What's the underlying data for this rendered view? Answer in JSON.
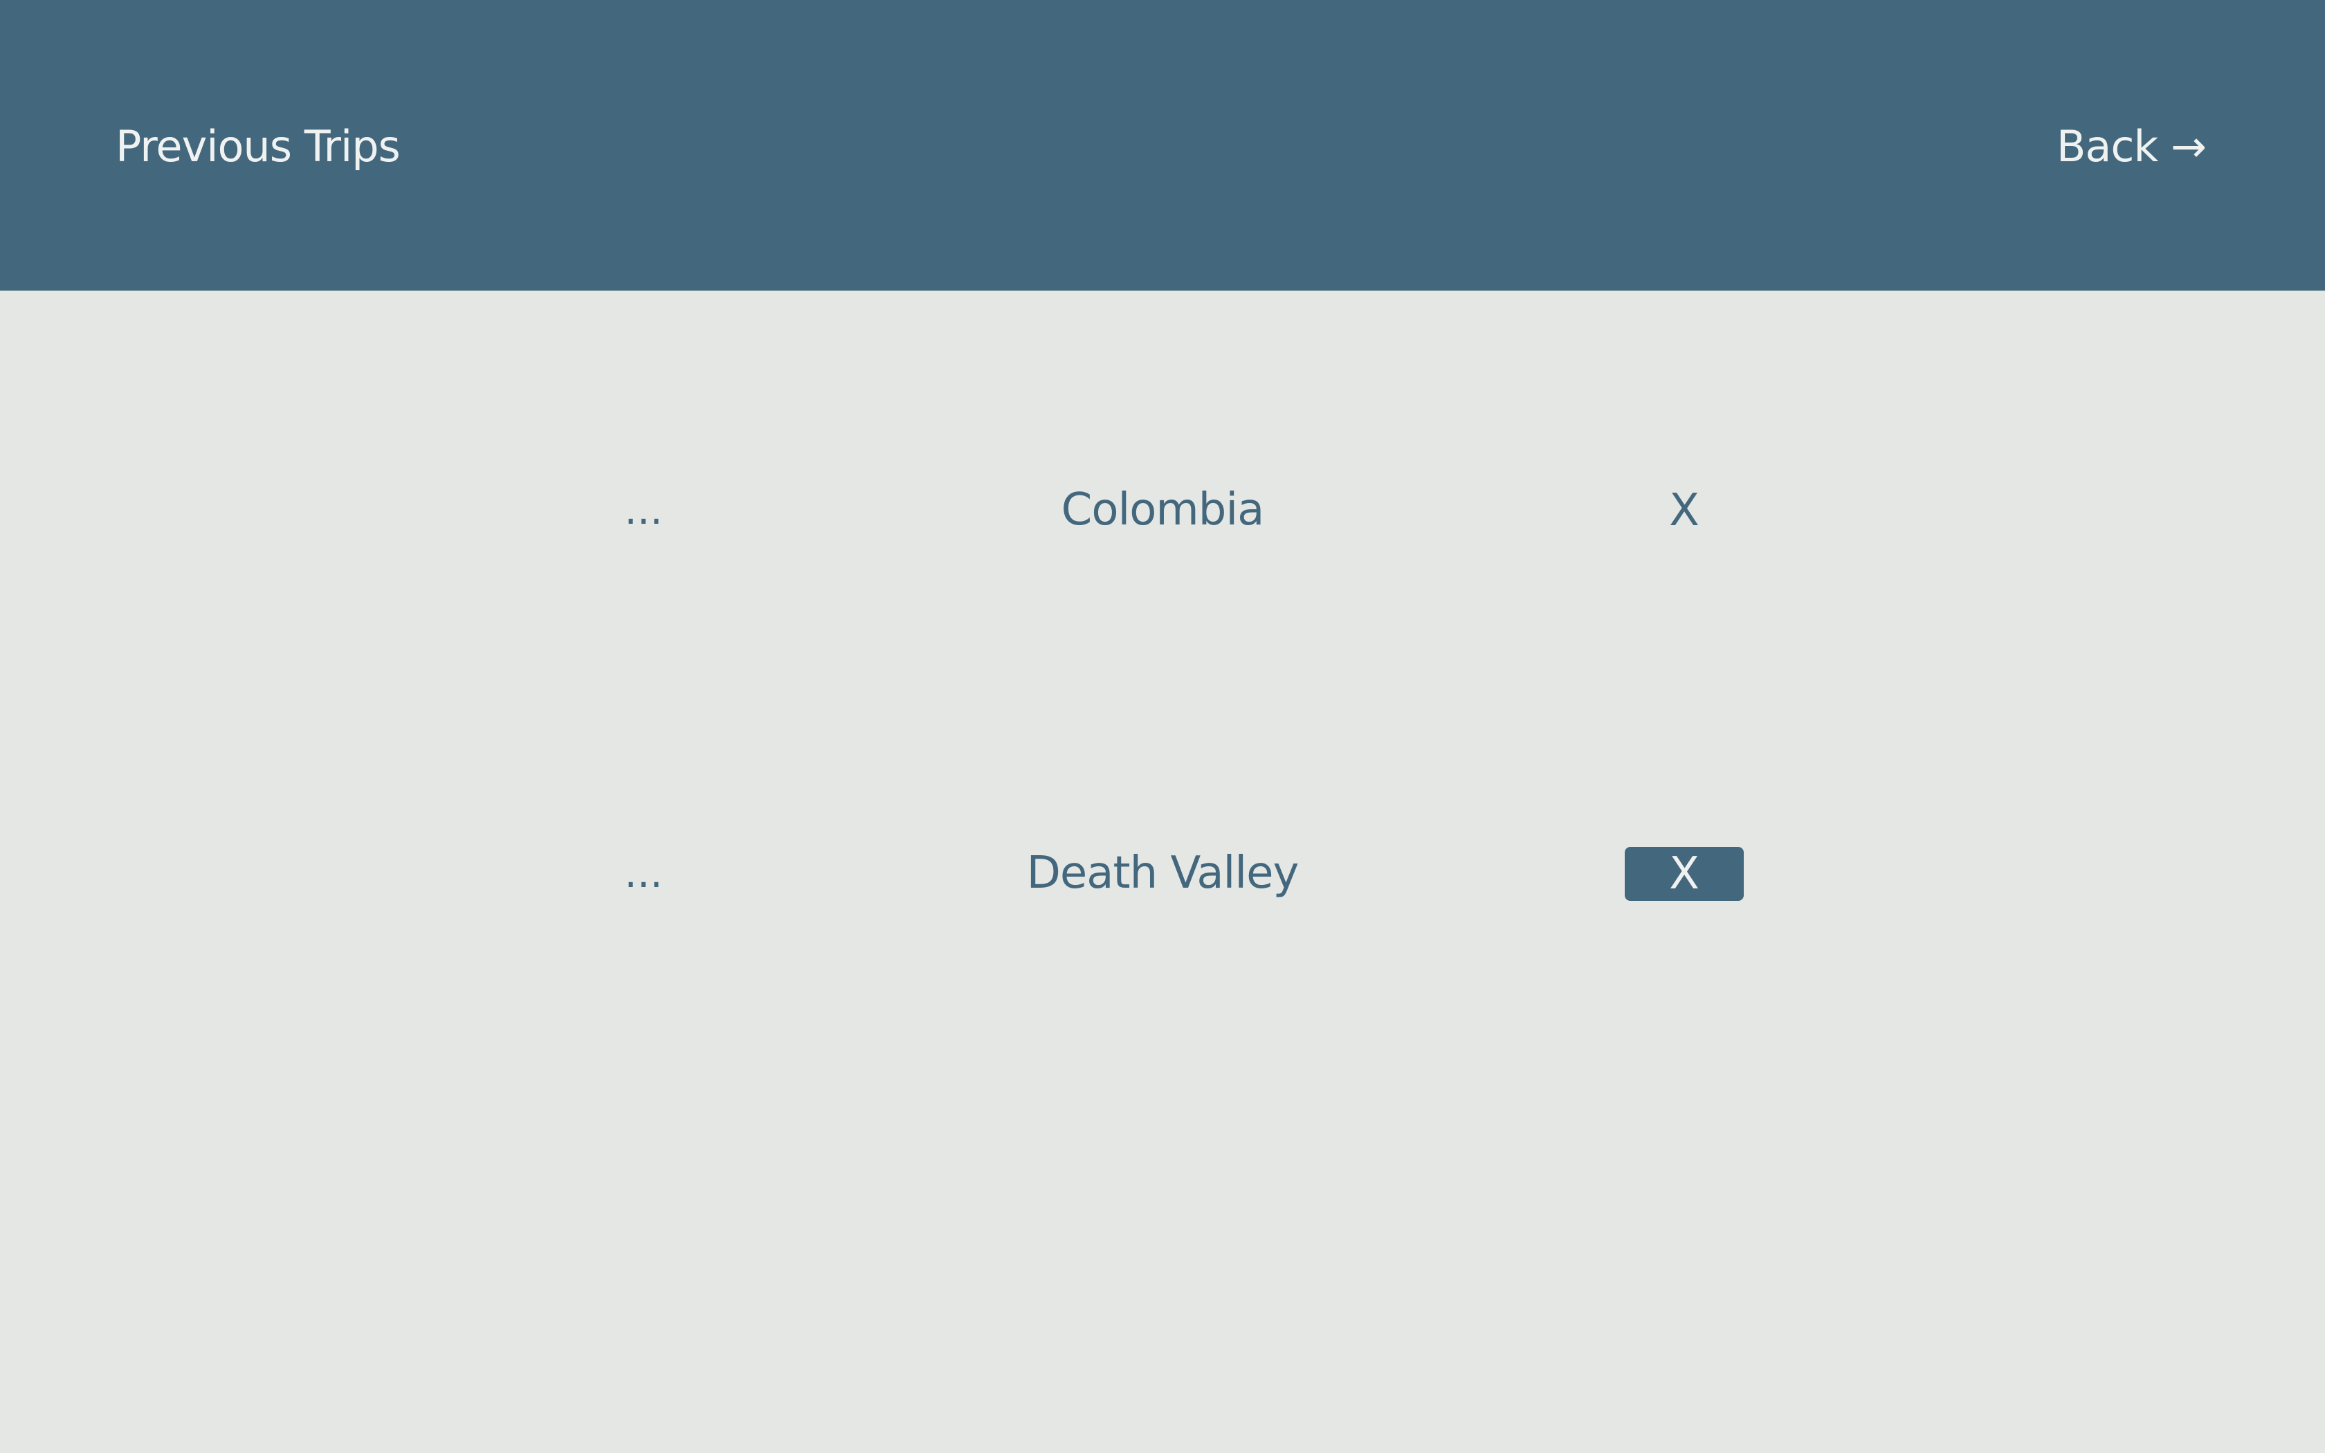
{
  "header": {
    "title": "Previous Trips",
    "back_label": "Back →"
  },
  "colors": {
    "header_bg": "#43677c",
    "page_bg": "#e5e7e5",
    "accent": "#43677c",
    "header_text": "#f0f2f1"
  },
  "trips": [
    {
      "menu_label": "...",
      "name": "Colombia",
      "delete_label": "X",
      "delete_highlighted": false
    },
    {
      "menu_label": "...",
      "name": "Death Valley",
      "delete_label": "X",
      "delete_highlighted": true
    }
  ]
}
